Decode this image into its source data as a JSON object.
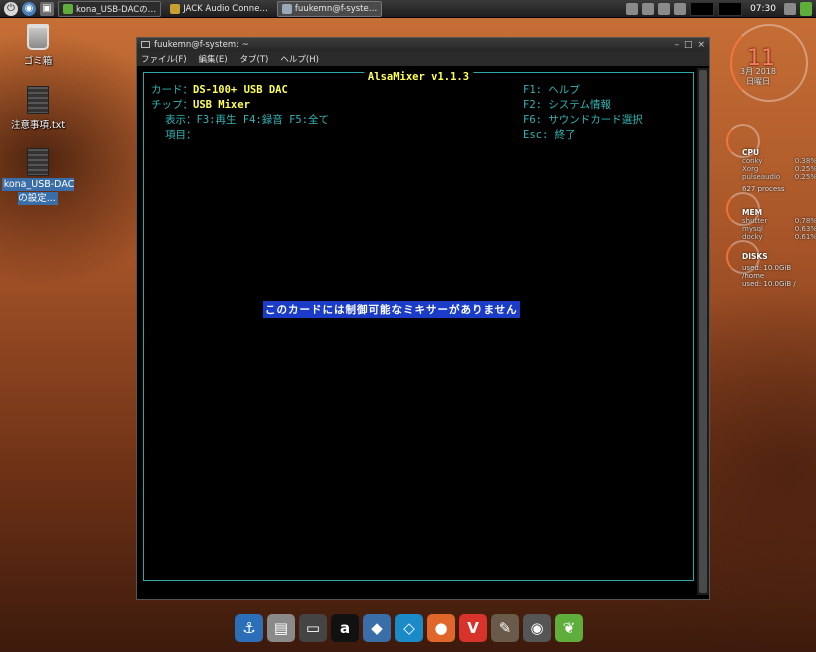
{
  "panel": {
    "tasks": [
      {
        "label": "kona_USB-DACの…",
        "color": "#5fae3c"
      },
      {
        "label": "JACK Audio Conne…",
        "color": "#c8a030"
      },
      {
        "label": "fuukemn@f-syste…",
        "color": "#9aa8b8"
      }
    ],
    "clock": "07:30"
  },
  "desktop": {
    "trash_label": "ゴミ箱",
    "file1_label": "注意事項.txt",
    "file2_label": "kona_USB-DACの設定..."
  },
  "terminal": {
    "title": "fuukemn@f-system: ~",
    "menu": [
      "ファイル(F)",
      "編集(E)",
      "タブ(T)",
      "ヘルプ(H)"
    ],
    "mixer": {
      "title": "AlsaMixer v1.1.3",
      "card_label": "カード：",
      "card_value": "DS-100+ USB DAC",
      "chip_label": "チップ：",
      "chip_value": "USB Mixer",
      "view_label": "表示：",
      "view_options": "F3:再生  F4:録音  F5:全て",
      "item_label": "項目：",
      "keys": [
        {
          "key": "F1:",
          "text": "ヘルプ"
        },
        {
          "key": "F2:",
          "text": "システム情報"
        },
        {
          "key": "F6:",
          "text": "サウンドカード選択"
        },
        {
          "key": "Esc:",
          "text": "終了"
        }
      ],
      "message": "このカードには制御可能なミキサーがありません"
    }
  },
  "conky": {
    "day": "11",
    "month_year": "3月 2018",
    "weekday": "日曜日",
    "cpu_head": "CPU",
    "cpu_procs": [
      {
        "name": "conky",
        "value": "0.38%"
      },
      {
        "name": "Xorg",
        "value": "0.25%"
      },
      {
        "name": "pulseaudio",
        "value": "0.25%"
      }
    ],
    "process_count": "627 process",
    "mem_head": "MEM",
    "mem_procs": [
      {
        "name": "shutter",
        "value": "0.78%"
      },
      {
        "name": "mysql",
        "value": "0.63%"
      },
      {
        "name": "docky",
        "value": "0.61%"
      }
    ],
    "disks_head": "DISKS",
    "disk_home": "used: 10.0GiB /home",
    "disk_root": "used: 10.0GiB /"
  },
  "dock": {
    "items": [
      {
        "name": "anchor",
        "color": "#2a6fb8",
        "glyph": "⚓"
      },
      {
        "name": "printer",
        "color": "#8a8a8a",
        "glyph": "▤"
      },
      {
        "name": "monitor",
        "color": "#444444",
        "glyph": "▭"
      },
      {
        "name": "amazon",
        "color": "#111111",
        "glyph": "a"
      },
      {
        "name": "vpn",
        "color": "#3a6ea8",
        "glyph": "◆"
      },
      {
        "name": "kodi",
        "color": "#1a8ac8",
        "glyph": "◇"
      },
      {
        "name": "firefox",
        "color": "#e0662a",
        "glyph": "●"
      },
      {
        "name": "vivaldi",
        "color": "#d8332a",
        "glyph": "V"
      },
      {
        "name": "tools",
        "color": "#6a5a4a",
        "glyph": "✎"
      },
      {
        "name": "camera",
        "color": "#555555",
        "glyph": "◉"
      },
      {
        "name": "leaf",
        "color": "#5fae3c",
        "glyph": "❦"
      }
    ]
  }
}
